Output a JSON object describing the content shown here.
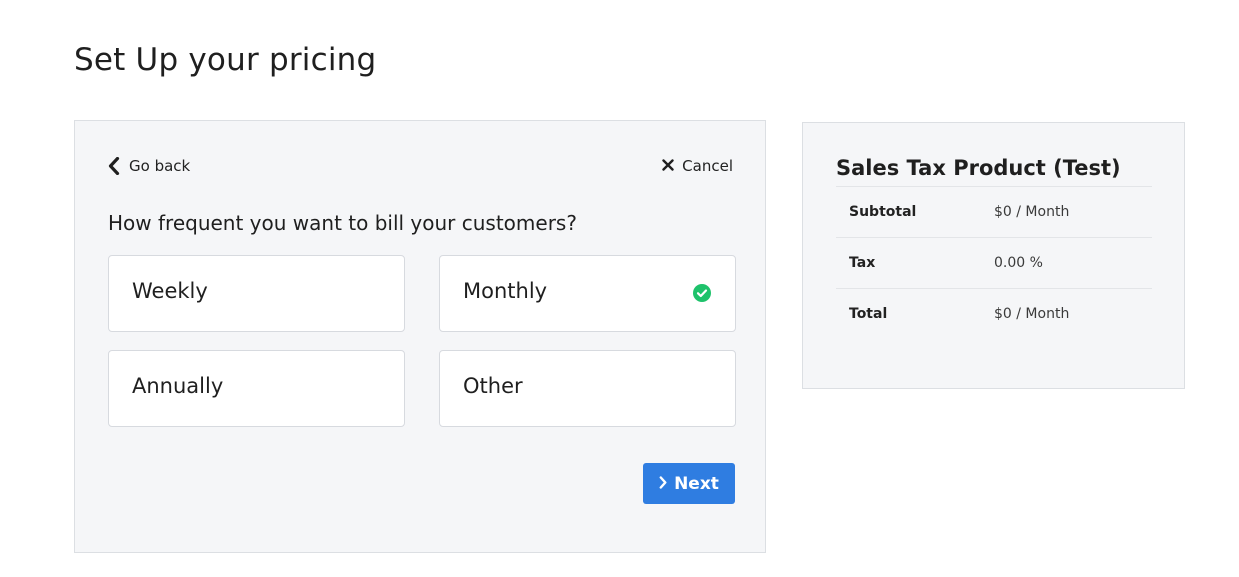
{
  "page": {
    "title": "Set Up your pricing"
  },
  "wizard": {
    "back_label": "Go back",
    "cancel_label": "Cancel",
    "question": "How frequent you want to bill your customers?",
    "options": [
      {
        "label": "Weekly",
        "selected": false
      },
      {
        "label": "Monthly",
        "selected": true
      },
      {
        "label": "Annually",
        "selected": false
      },
      {
        "label": "Other",
        "selected": false
      }
    ],
    "next_label": "Next"
  },
  "summary": {
    "title": "Sales Tax Product (Test)",
    "rows": [
      {
        "label": "Subtotal",
        "value": "$0 / Month"
      },
      {
        "label": "Tax",
        "value": "0.00 %"
      },
      {
        "label": "Total",
        "value": "$0 / Month"
      }
    ]
  },
  "colors": {
    "accent": "#2f7de1",
    "selected_check": "#1ec26b",
    "card_background": "#f5f6f8"
  },
  "icons": {
    "back": "chevron-left-icon",
    "cancel": "close-icon",
    "selected": "check-circle-icon",
    "next": "chevron-right-icon"
  }
}
